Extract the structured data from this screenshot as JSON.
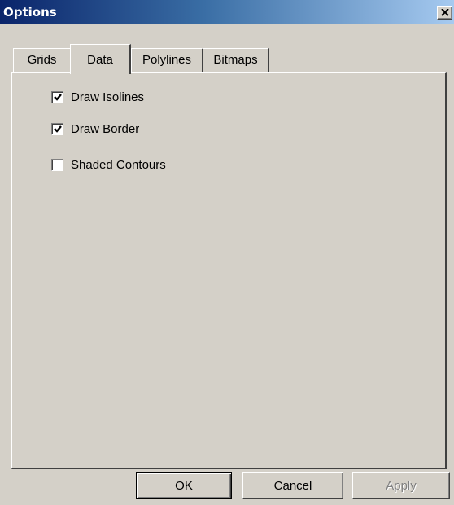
{
  "window": {
    "title": "Options"
  },
  "tabs": [
    {
      "label": "Grids",
      "active": false
    },
    {
      "label": "Data",
      "active": true
    },
    {
      "label": "Polylines",
      "active": false
    },
    {
      "label": "Bitmaps",
      "active": false
    }
  ],
  "options": [
    {
      "label": "Draw Isolines",
      "checked": true
    },
    {
      "label": "Draw Border",
      "checked": true
    },
    {
      "label": "Shaded Contours",
      "checked": false
    }
  ],
  "buttons": {
    "ok_label": "OK",
    "cancel_label": "Cancel",
    "apply_label": "Apply",
    "apply_enabled": false
  },
  "icons": {
    "close": "close-icon",
    "check": "checkmark-icon"
  },
  "colors": {
    "titlebar_start": "#0a246a",
    "titlebar_end": "#a6caf0",
    "face": "#d4d0c8"
  }
}
